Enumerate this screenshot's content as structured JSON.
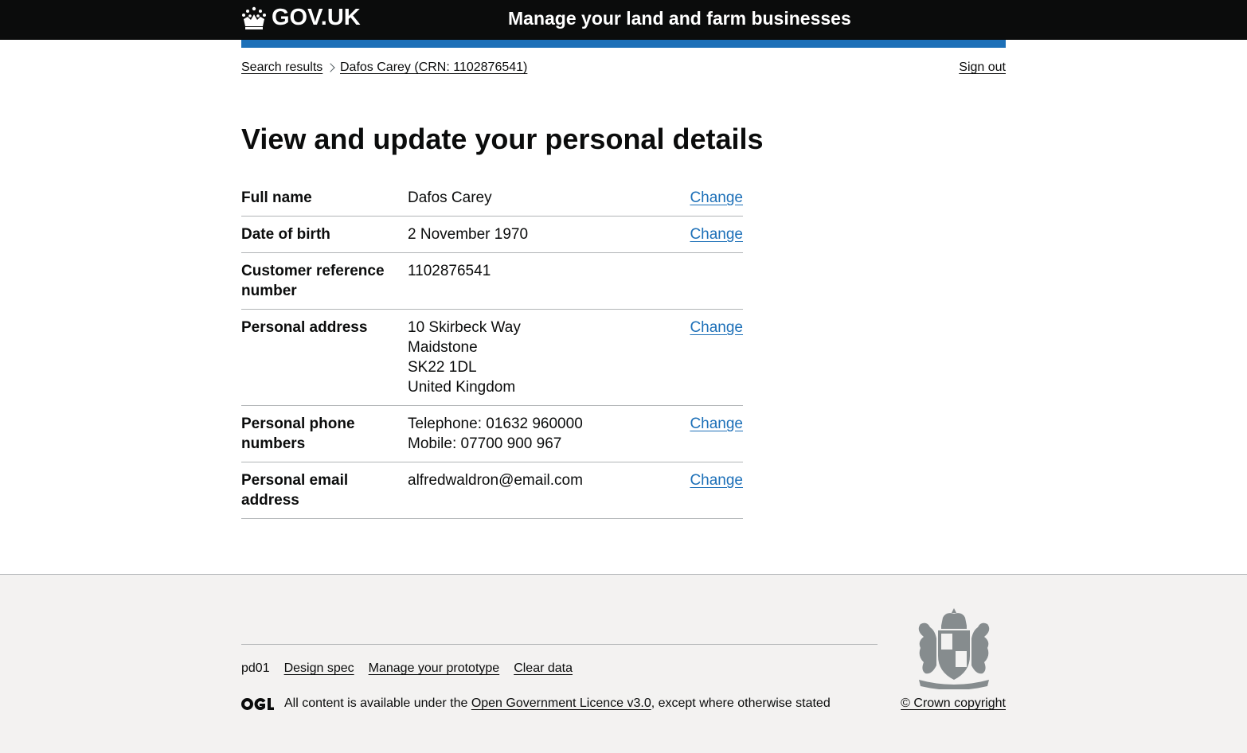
{
  "header": {
    "logo_text": "GOV.UK",
    "service_name": "Manage your land and farm businesses"
  },
  "breadcrumbs": [
    {
      "label": "Search results"
    },
    {
      "label": "Dafos Carey (CRN: 1102876541)"
    }
  ],
  "sign_out": "Sign out",
  "page_title": "View and update your personal details",
  "summary": {
    "rows": [
      {
        "key": "Full name",
        "value": [
          "Dafos Carey"
        ],
        "action": "Change"
      },
      {
        "key": "Date of birth",
        "value": [
          "2 November 1970"
        ],
        "action": "Change"
      },
      {
        "key": "Customer reference number",
        "value": [
          "1102876541"
        ],
        "action": ""
      },
      {
        "key": "Personal address",
        "value": [
          "10 Skirbeck Way",
          "Maidstone",
          "SK22 1DL",
          "United Kingdom"
        ],
        "action": "Change"
      },
      {
        "key": "Personal phone numbers",
        "value": [
          "Telephone: 01632 960000",
          "Mobile: 07700 900 967"
        ],
        "action": "Change"
      },
      {
        "key": "Personal email address",
        "value": [
          "alfredwaldron@email.com"
        ],
        "action": "Change"
      }
    ]
  },
  "footer": {
    "links": [
      "pd01",
      "Design spec",
      "Manage your prototype",
      "Clear data"
    ],
    "licence_prefix": "All content is available under the ",
    "licence_link": "Open Government Licence v3.0",
    "licence_suffix": ", except where otherwise stated",
    "copyright": "© Crown copyright"
  },
  "colors": {
    "header_bg": "#0b0c0c",
    "brand_blue": "#1d70b8",
    "footer_bg": "#f3f2f1",
    "border": "#b1b4b6"
  },
  "icons": [
    "crown-icon",
    "ogl-logo-icon",
    "royal-crest-icon",
    "chevron-right-icon"
  ]
}
